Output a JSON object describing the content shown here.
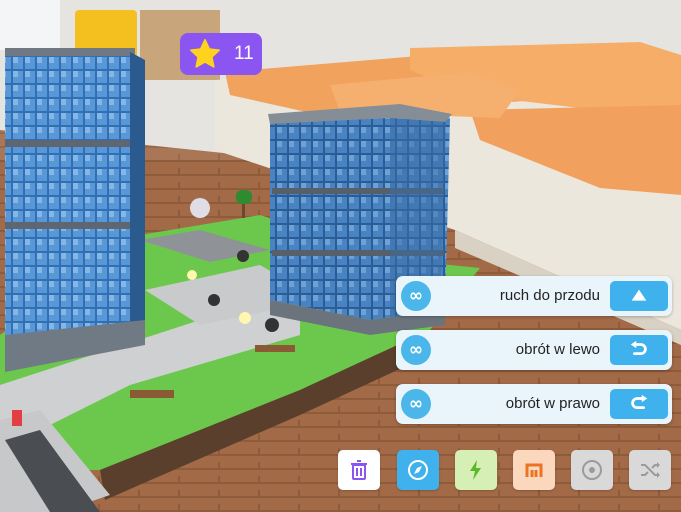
{
  "hud": {
    "stars": "11",
    "star_badge_color": "#8a55f0",
    "star_icon_color": "#ffd21e"
  },
  "commands": [
    {
      "label": "ruch do przodu",
      "loop_icon": "infinity-icon",
      "action_icon": "arrow-up-icon"
    },
    {
      "label": "obrót w lewo",
      "loop_icon": "infinity-icon",
      "action_icon": "rotate-left-icon"
    },
    {
      "label": "obrót w prawo",
      "loop_icon": "infinity-icon",
      "action_icon": "rotate-right-icon"
    }
  ],
  "command_colors": {
    "panel": "#eaf4fb",
    "loop_button": "#4ab6ea",
    "action_button": "#3fb1ec"
  },
  "loop_symbol": "∞",
  "toolbar": [
    {
      "name": "delete",
      "icon": "trash-icon",
      "color": "#ffffff",
      "icon_color": "#8a55f0"
    },
    {
      "name": "compass",
      "icon": "compass-icon",
      "color": "#3fb1ec",
      "icon_color": "#ffffff"
    },
    {
      "name": "lightning",
      "icon": "lightning-icon",
      "color": "#d6efb4",
      "icon_color": "#5bb72d"
    },
    {
      "name": "loop",
      "icon": "loop-bracket-icon",
      "color": "#fbd8bd",
      "icon_color": "#e87424"
    },
    {
      "name": "target",
      "icon": "target-icon",
      "color": "#d9d9d9",
      "icon_color": "#9b9b9b"
    },
    {
      "name": "shuffle",
      "icon": "shuffle-icon",
      "color": "#d9d9d9",
      "icon_color": "#9b9b9b"
    }
  ]
}
